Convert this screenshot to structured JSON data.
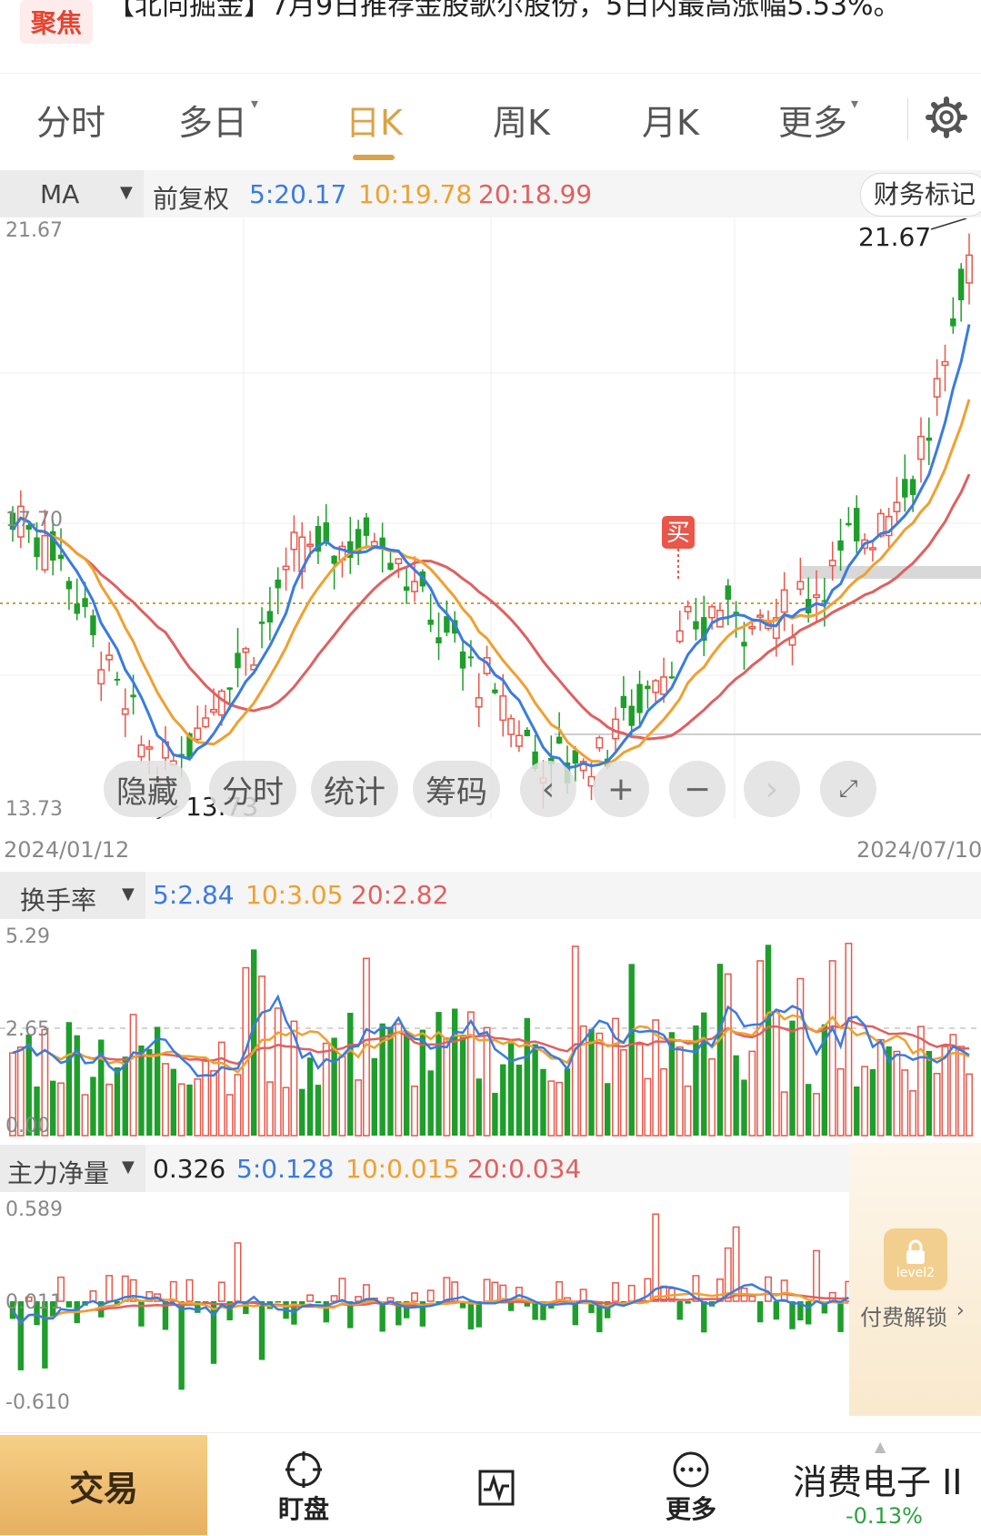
{
  "banner": {
    "logo": "聚焦",
    "text": "【北向掘金】7月9日推荐金股歌尔股份，5日内最高涨幅5.53%。"
  },
  "tabs": [
    {
      "label": "分时",
      "dropdown": false
    },
    {
      "label": "多日",
      "dropdown": true
    },
    {
      "label": "日K",
      "dropdown": false,
      "active": true
    },
    {
      "label": "周K",
      "dropdown": false
    },
    {
      "label": "月K",
      "dropdown": false
    },
    {
      "label": "更多",
      "dropdown": true
    }
  ],
  "ma": {
    "select": "MA",
    "adjust": "前复权",
    "ma5": "5:20.17",
    "ma10": "10:19.78",
    "ma20": "20:18.99",
    "finance_btn": "财务标记"
  },
  "price_axis": {
    "top": "21.67",
    "mid": "17.70",
    "bottom": "13.73",
    "high_label": "21.67",
    "low_label": "13.73",
    "buy_marker": "买"
  },
  "dates": {
    "start": "2024/01/12",
    "end": "2024/07/10"
  },
  "controls": {
    "hide": "隐藏",
    "intraday": "分时",
    "stats": "统计",
    "chips": "筹码"
  },
  "turnover": {
    "select": "换手率",
    "ma5": "5:2.84",
    "ma10": "10:3.05",
    "ma20": "20:2.82",
    "top": "5.29",
    "mid": "2.65",
    "bottom": "0.00"
  },
  "mainflow": {
    "select": "主力净量",
    "value": "0.326",
    "ma5": "5:0.128",
    "ma10": "10:0.015",
    "ma20": "20:0.034",
    "top": "0.589",
    "mid": "0.011",
    "bottom": "-0.610",
    "lock_text": "付费解锁",
    "lock_badge": "level2"
  },
  "bottom_bar": {
    "trade": "交易",
    "watch": "盯盘",
    "more": "更多",
    "sector": "消费电子 II",
    "sector_change": "-0.13%"
  },
  "colors": {
    "up": "#e8574a",
    "down": "#1e9e2a",
    "ma5": "#3a7be0",
    "ma10": "#f0a030",
    "ma20": "#e06060",
    "accent": "#d9a34a"
  },
  "chart_data": {
    "type": "candlestick",
    "x_range": [
      "2024/01/12",
      "2024/07/10"
    ],
    "ylim": [
      13.73,
      21.67
    ],
    "series_notes": "Daily K-line with MA5/MA10/MA20 overlays; high 21.67, low 13.73"
  }
}
